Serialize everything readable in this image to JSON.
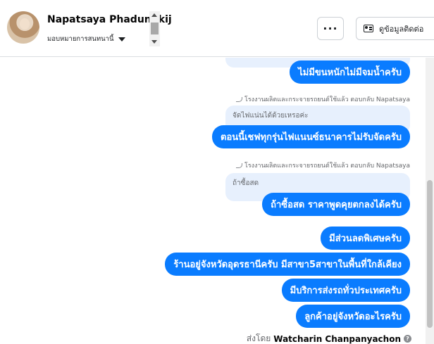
{
  "header": {
    "name": "Napatsaya Phadungkij",
    "assign_label": "มอบหมายการสนทนานี้",
    "more_label": "···",
    "contact_label": "ดูข้อมูลติดต่อ"
  },
  "messages": [
    {
      "kind": "outgoing",
      "text": "ไม่มีขนหนักไม่มีจมน้ำครับ"
    },
    {
      "kind": "reply_meta",
      "text": "โรงงานผลิตและกระจายรถยนต์ใช้แล้ว ตอบกลับ Napatsaya"
    },
    {
      "kind": "quote",
      "text": "จัดไฟแน่นได้ด้วยเหรอค่ะ"
    },
    {
      "kind": "outgoing",
      "text": "ตอนนี้เชฟทุกรุ่นไฟแนนซ์ธนาคารไม่รับจัดครับ"
    },
    {
      "kind": "reply_meta",
      "text": "โรงงานผลิตและกระจายรถยนต์ใช้แล้ว ตอบกลับ Napatsaya"
    },
    {
      "kind": "quote",
      "text": "ถ้าซื้อสด"
    },
    {
      "kind": "outgoing",
      "text": "ถ้าซื้อสด ราคาพูดคุยตกลงได้ครับ"
    },
    {
      "kind": "outgoing",
      "text": "มีส่วนลดพิเศษครับ"
    },
    {
      "kind": "outgoing",
      "text": "ร้านอยู่จังหวัดอุดรธานีครับ มีสาขา5สาขาในพื้นที่ใกล้เคียง"
    },
    {
      "kind": "outgoing",
      "text": "มีบริการส่งรถทั่วประเทศครับ"
    },
    {
      "kind": "outgoing",
      "text": "ลูกค้าอยู่จังหวัดอะไรครับ"
    }
  ],
  "sent_by": {
    "prefix": "ส่งโดย",
    "name": "Watcharin Chanpanyachon"
  },
  "colors": {
    "outgoing_bubble": "#0a7cff",
    "quote_bubble": "#e7f0fd",
    "meta_text": "#65676b"
  },
  "icons": {
    "more": "ellipsis-icon",
    "contact": "contact-card-icon",
    "assign": "caret-down-icon",
    "reply": "reply-arrow-icon",
    "info": "info-icon"
  }
}
